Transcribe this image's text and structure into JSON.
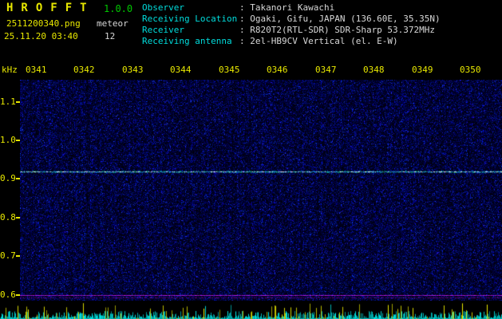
{
  "colors": {
    "yellow": "#e8e800",
    "green": "#00c800",
    "cyan": "#00dcdc",
    "white": "#d8d8d8",
    "carrier": "#90ffff",
    "magenta": "#c040f0",
    "meter_cyan": "#00e8e8",
    "meter_yellow": "#f0f000"
  },
  "header": {
    "app_title": "HROFFT",
    "version": "1.0.0",
    "filename": "2511200340.png",
    "mode": "meteor",
    "datetime": "25.11.20 03:40",
    "count": "12",
    "info": [
      {
        "label": "Observer",
        "value": ": Takanori Kawachi"
      },
      {
        "label": "Receiving Location",
        "value": ": Ogaki, Gifu, JAPAN (136.60E, 35.35N)"
      },
      {
        "label": "Receiver",
        "value": ": R820T2(RTL-SDR) SDR-Sharp 53.372MHz"
      },
      {
        "label": "Receiving antenna",
        "value": ": 2el-HB9CV Vertical (el. E-W)"
      }
    ]
  },
  "spectrogram": {
    "unit_label": "kHz",
    "time_labels": [
      "0341",
      "0342",
      "0343",
      "0344",
      "0345",
      "0346",
      "0347",
      "0348",
      "0349",
      "0350"
    ],
    "freq_labels": [
      "1.1",
      "1.0",
      "0.9",
      "0.8",
      "0.7",
      "0.6"
    ],
    "carrier_freq_khz": 0.92,
    "baseline_freq_khz": 0.6
  }
}
